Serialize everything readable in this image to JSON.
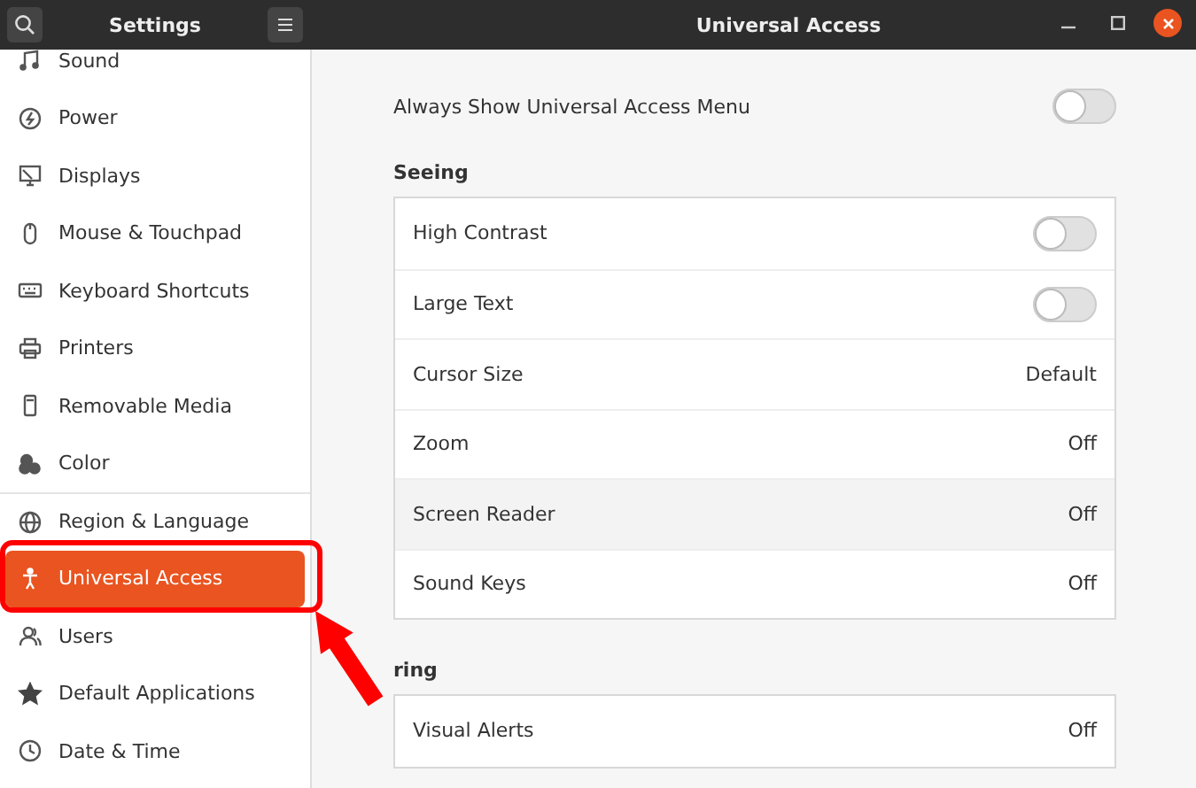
{
  "header": {
    "sidebar_title": "Settings",
    "title": "Universal Access"
  },
  "sidebar": {
    "items": [
      {
        "label": "Sound",
        "selected": false
      },
      {
        "label": "Power",
        "selected": false
      },
      {
        "label": "Displays",
        "selected": false
      },
      {
        "label": "Mouse & Touchpad",
        "selected": false
      },
      {
        "label": "Keyboard Shortcuts",
        "selected": false
      },
      {
        "label": "Printers",
        "selected": false
      },
      {
        "label": "Removable Media",
        "selected": false
      },
      {
        "label": "Color",
        "selected": false
      },
      {
        "label": "Region & Language",
        "selected": false
      },
      {
        "label": "Universal Access",
        "selected": true
      },
      {
        "label": "Users",
        "selected": false
      },
      {
        "label": "Default Applications",
        "selected": false
      },
      {
        "label": "Date & Time",
        "selected": false
      }
    ]
  },
  "top_setting": {
    "label": "Always Show Universal Access Menu",
    "on": false
  },
  "sections": [
    {
      "heading": "Seeing",
      "rows": [
        {
          "kind": "switch",
          "label": "High Contrast",
          "on": false,
          "highlighted": false
        },
        {
          "kind": "switch",
          "label": "Large Text",
          "on": false,
          "highlighted": false
        },
        {
          "kind": "value",
          "label": "Cursor Size",
          "value": "Default",
          "highlighted": false
        },
        {
          "kind": "value",
          "label": "Zoom",
          "value": "Off",
          "highlighted": false
        },
        {
          "kind": "value",
          "label": "Screen Reader",
          "value": "Off",
          "highlighted": true
        },
        {
          "kind": "value",
          "label": "Sound Keys",
          "value": "Off",
          "highlighted": false
        }
      ]
    },
    {
      "heading": "ring",
      "rows": [
        {
          "kind": "value",
          "label": "Visual Alerts",
          "value": "Off",
          "highlighted": false
        }
      ]
    }
  ]
}
